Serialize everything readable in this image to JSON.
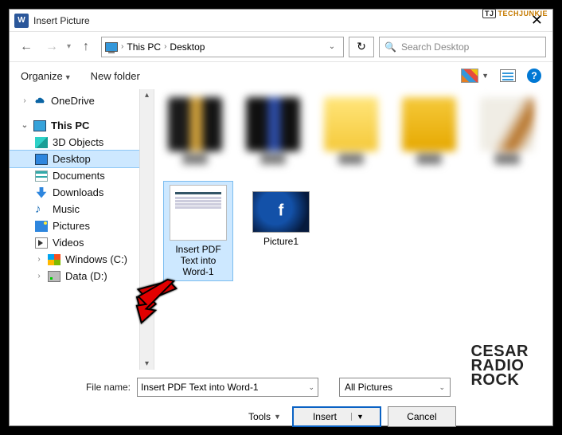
{
  "watermark_top": "TECHJUNKIE",
  "title": "Insert Picture",
  "breadcrumb": {
    "root_icon": "pc",
    "items": [
      "This PC",
      "Desktop"
    ]
  },
  "search": {
    "placeholder": "Search Desktop"
  },
  "toolbar": {
    "organize": "Organize",
    "new_folder": "New folder"
  },
  "sidebar": {
    "onedrive": "OneDrive",
    "this_pc": "This PC",
    "children": [
      "3D Objects",
      "Desktop",
      "Documents",
      "Downloads",
      "Music",
      "Pictures",
      "Videos",
      "Windows (C:)",
      "Data (D:)"
    ],
    "selected": "Desktop"
  },
  "content": {
    "tiles": [
      {
        "name": "Insert PDF Text into Word-1",
        "kind": "doc",
        "selected": true
      },
      {
        "name": "Picture1",
        "kind": "fb",
        "selected": false
      }
    ]
  },
  "footer": {
    "file_name_label": "File name:",
    "file_name_value": "Insert PDF Text into Word-1",
    "filter_label": "All Pictures",
    "tools_label": "Tools",
    "insert_label": "Insert",
    "cancel_label": "Cancel"
  },
  "watermark_bottom": [
    "CESAR",
    "RADIO",
    "ROCK"
  ]
}
